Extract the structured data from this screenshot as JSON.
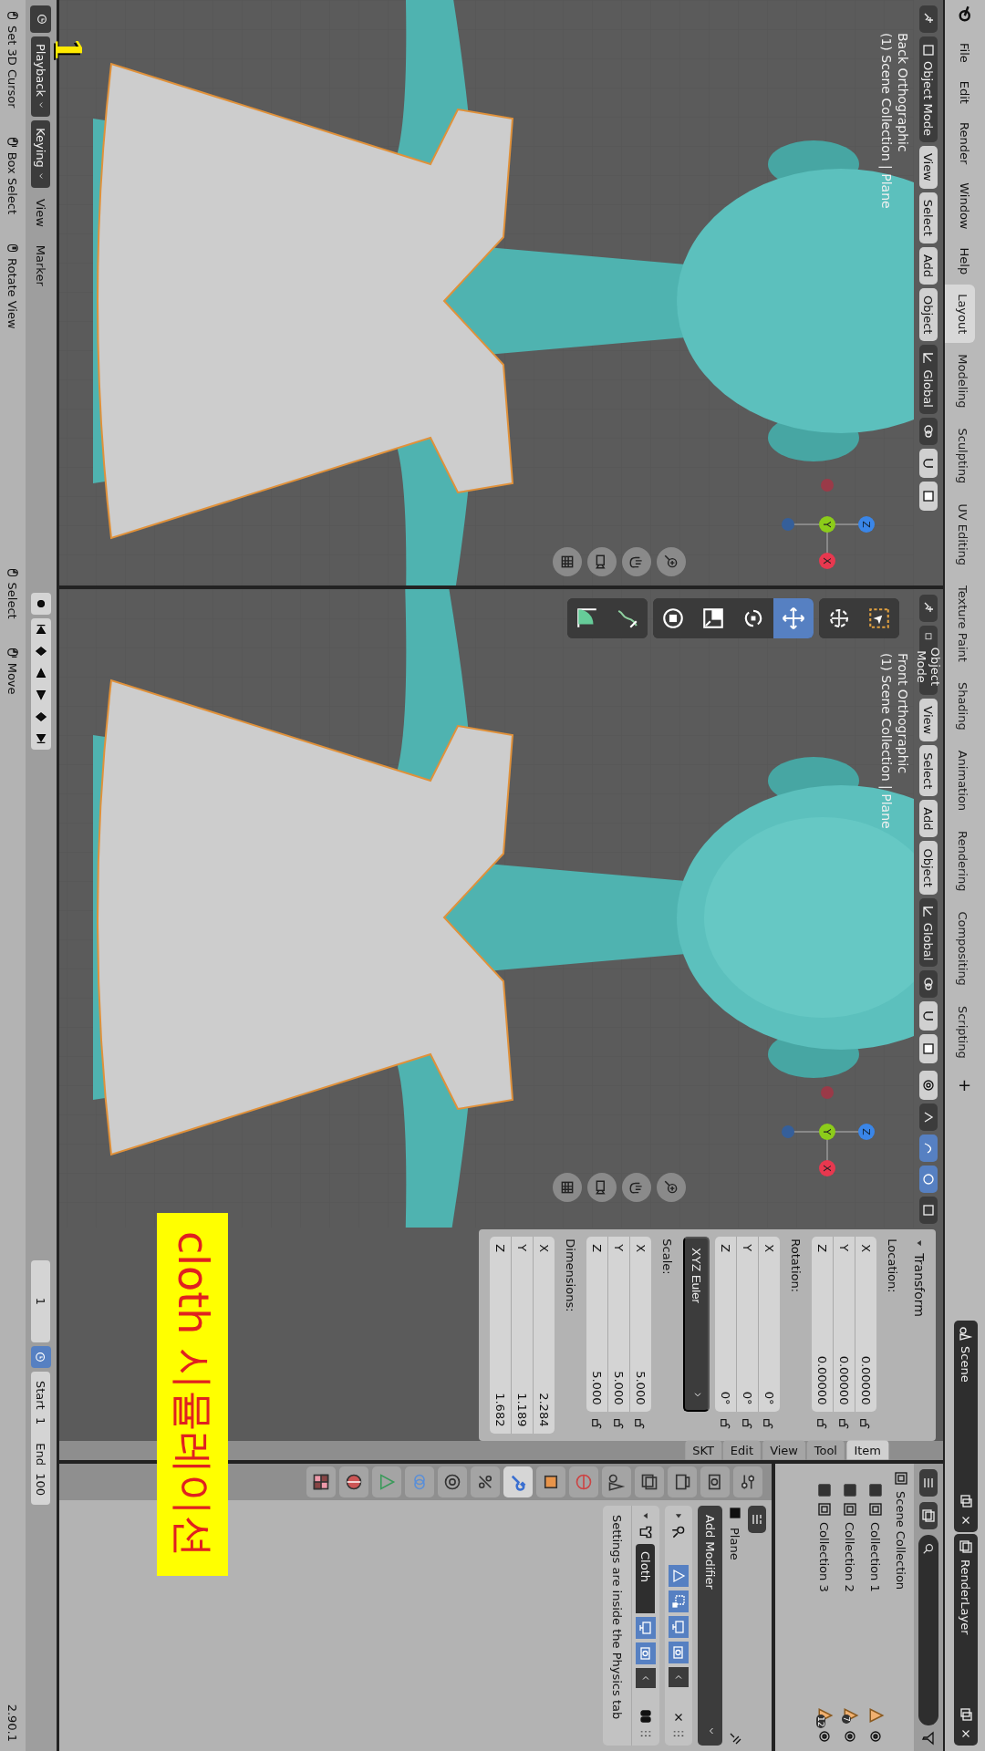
{
  "top_bar": {
    "menus": [
      "File",
      "Edit",
      "Render",
      "Window",
      "Help"
    ],
    "workspaces": [
      {
        "label": "Layout",
        "selected": true
      },
      {
        "label": "Modeling",
        "selected": false
      },
      {
        "label": "Sculpting",
        "selected": false
      },
      {
        "label": "UV Editing",
        "selected": false
      },
      {
        "label": "Texture Paint",
        "selected": false
      },
      {
        "label": "Shading",
        "selected": false
      },
      {
        "label": "Animation",
        "selected": false
      },
      {
        "label": "Rendering",
        "selected": false
      },
      {
        "label": "Compositing",
        "selected": false
      },
      {
        "label": "Scripting",
        "selected": false
      }
    ],
    "add_tab": "+",
    "scene": "Scene",
    "view_layer": "RenderLayer"
  },
  "viewports": [
    {
      "kind": "back",
      "mode": "Object Mode",
      "menus": [
        "View",
        "Select",
        "Add",
        "Object"
      ],
      "orientation": "Global",
      "view_name": "Back Orthographic",
      "collection_info": "(1) Scene Collection | Plane",
      "gizmo_axes": [
        "X",
        "Y",
        "Z"
      ]
    },
    {
      "kind": "front",
      "mode": "Object Mode",
      "menus": [
        "View",
        "Select",
        "Add",
        "Object"
      ],
      "orientation": "Global",
      "view_name": "Front Orthographic",
      "collection_info": "(1) Scene Collection | Plane",
      "gizmo_axes": [
        "X",
        "Y",
        "Z"
      ]
    }
  ],
  "toolbar": [
    {
      "selected": false
    },
    {
      "selected": false
    },
    {
      "selected": true
    },
    {
      "selected": false
    },
    {
      "selected": false
    },
    {
      "selected": false
    },
    {
      "selected": false
    },
    {
      "selected": false
    }
  ],
  "sidebar": {
    "tabs": [
      {
        "label": "SKT",
        "selected": false
      },
      {
        "label": "Edit",
        "selected": false
      },
      {
        "label": "View",
        "selected": false
      },
      {
        "label": "Tool",
        "selected": false
      },
      {
        "label": "Item",
        "selected": true
      }
    ],
    "transform": {
      "title": "Transform",
      "groups": [
        {
          "label": "Location:",
          "rows": [
            {
              "axis": "X",
              "value": "0.00000"
            },
            {
              "axis": "Y",
              "value": "0.00000"
            },
            {
              "axis": "Z",
              "value": "0.00000"
            }
          ],
          "locks": true
        },
        {
          "label": "Rotation:",
          "rows": [
            {
              "axis": "X",
              "value": "0°"
            },
            {
              "axis": "Y",
              "value": "0°"
            },
            {
              "axis": "Z",
              "value": "0°"
            }
          ],
          "locks": true,
          "mode": "XYZ Euler"
        },
        {
          "label": "Scale:",
          "rows": [
            {
              "axis": "X",
              "value": "5.000"
            },
            {
              "axis": "Y",
              "value": "5.000"
            },
            {
              "axis": "Z",
              "value": "5.000"
            }
          ],
          "locks": true
        },
        {
          "label": "Dimensions:",
          "rows": [
            {
              "axis": "X",
              "value": "2.284"
            },
            {
              "axis": "Y",
              "value": "1.189"
            },
            {
              "axis": "Z",
              "value": "1.682"
            }
          ],
          "locks": false
        }
      ]
    }
  },
  "outliner": {
    "rows": [
      {
        "label": "Scene Collection",
        "kind": "scene"
      },
      {
        "label": "Collection 1",
        "kind": "collection",
        "checked": true
      },
      {
        "label": "Collection 2",
        "kind": "collection",
        "checked": true,
        "count": "7"
      },
      {
        "label": "Collection 3",
        "kind": "collection",
        "checked": true,
        "count": "12"
      }
    ]
  },
  "properties": {
    "tabs": [
      {
        "selected": false
      },
      {
        "selected": false
      },
      {
        "selected": false
      },
      {
        "selected": false
      },
      {
        "selected": false
      },
      {
        "selected": false
      },
      {
        "selected": false
      },
      {
        "selected": true
      },
      {
        "selected": false
      },
      {
        "selected": false
      },
      {
        "selected": false
      },
      {
        "selected": false
      },
      {
        "selected": false
      },
      {
        "selected": false
      }
    ],
    "object_name": "Plane",
    "add_modifier": "Add Modifier",
    "modifiers": [
      {
        "kind": "hook",
        "expanded": false,
        "toggles": [
          {
            "on": true
          },
          {
            "on": true
          },
          {
            "on": true
          },
          {
            "on": true
          }
        ]
      },
      {
        "kind": "cloth",
        "expanded": true,
        "name": "Cloth",
        "toggles": [
          {
            "on": true
          },
          {
            "on": true
          }
        ],
        "note": "Settings are inside the Physics tab"
      }
    ]
  },
  "timeline": {
    "menus": [
      "Playback",
      "Keying",
      "View",
      "Marker"
    ],
    "current_frame": "1",
    "start_label": "Start",
    "start": "1",
    "end_label": "End",
    "end": "100"
  },
  "status_bar": {
    "hints": [
      "Set 3D Cursor",
      "Box Select",
      "Rotate View",
      "Select",
      "Move"
    ],
    "version": "2.90.1"
  },
  "annotations": {
    "caption": "cloth 시뮬레이션",
    "number": "1"
  }
}
